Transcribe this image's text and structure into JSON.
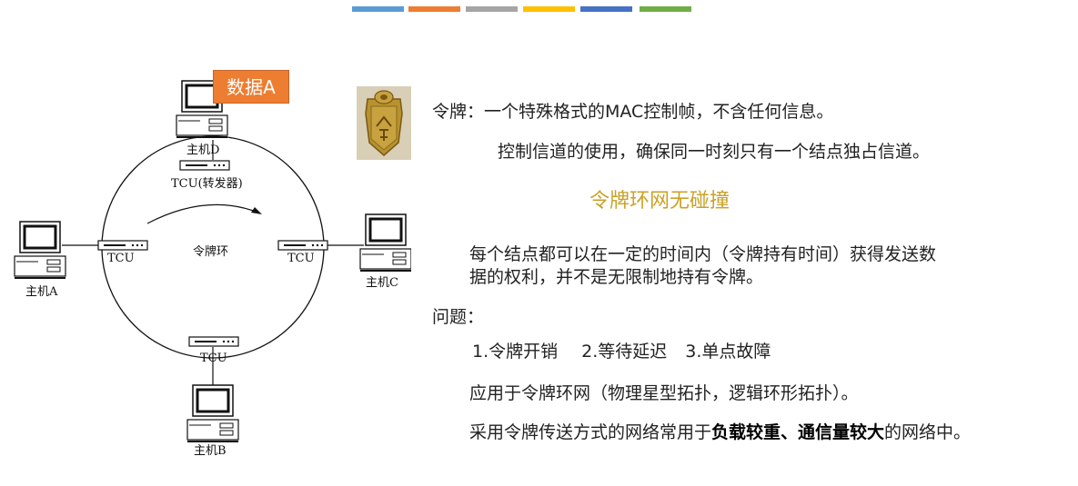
{
  "top_bar_colors": [
    "#5b9bd5",
    "#ed7d31",
    "#a5a5a5",
    "#ffc000",
    "#4472c4",
    "#70ad47"
  ],
  "data_tag": "数据A",
  "token_image": "token-plaque-icon",
  "diagram": {
    "host_d": "主机D",
    "host_a": "主机A",
    "host_b": "主机B",
    "host_c": "主机C",
    "tcu_top": "TCU(转发器)",
    "tcu_left": "TCU",
    "tcu_right": "TCU",
    "tcu_bottom": "TCU",
    "ring_label": "令牌环"
  },
  "text": {
    "line1": "令牌：一个特殊格式的MAC控制帧，不含任何信息。",
    "line2": "控制信道的使用，确保同一时刻只有一个结点独占信道。",
    "subtitle": "令牌环网无碰撞",
    "line3a": "每个结点都可以在一定的时间内（令牌持有时间）获得发送数",
    "line3b": "据的权利，并不是无限制地持有令牌。",
    "question": "问题：",
    "problem1": "1.令牌开销",
    "problem2": "2.等待延迟",
    "problem3": "3.单点故障",
    "application": "应用于令牌环网（物理星型拓扑，逻辑环形拓扑）。",
    "usage_prefix": "采用令牌传送方式的网络常用于",
    "usage_bold": "负载较重、通信量较大",
    "usage_suffix": "的网络中。"
  }
}
